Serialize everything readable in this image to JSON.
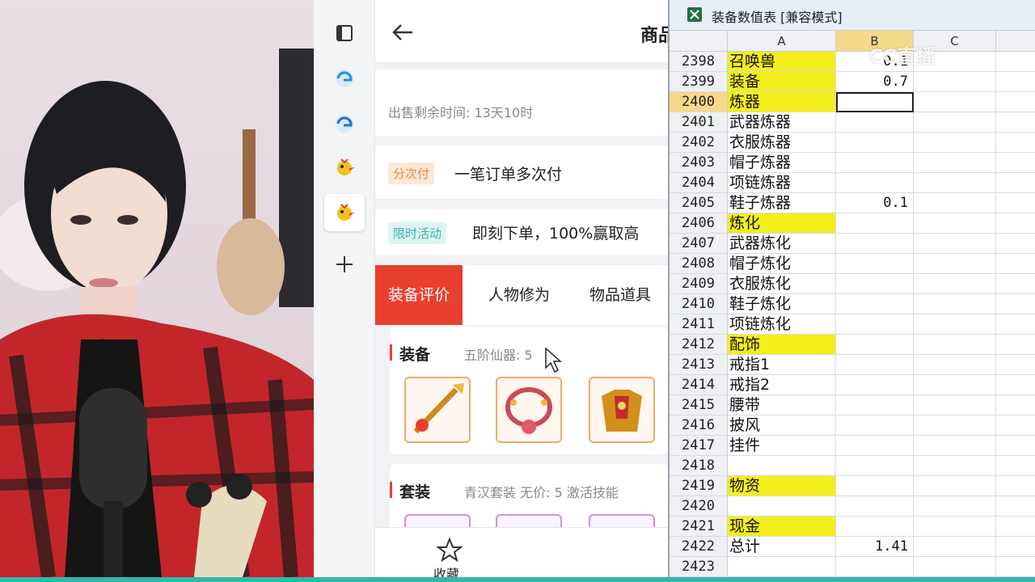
{
  "app": {
    "title": "商品",
    "sale_time": "出售剩余时间: 13天10时",
    "installment_tag": "分次付",
    "installment_text": "一笔订单多次付",
    "promo_tag": "限时活动",
    "promo_text": "即刻下单，100%赢取高",
    "tabs": [
      "装备评价",
      "人物修为",
      "物品道具"
    ],
    "equip_card": {
      "title": "装备",
      "subtitle": "五阶仙器: 5"
    },
    "suit_card": {
      "title": "套装",
      "subtitle": "青汉套装  无价: 5  激活技能"
    },
    "footer_label": "收藏"
  },
  "excel": {
    "title": "装备数值表  [兼容模式]",
    "watermark": "CC直播",
    "columns": [
      "A",
      "B",
      "C"
    ],
    "rows": [
      {
        "n": "2398",
        "a": "召唤兽",
        "b": "0.1",
        "hl": true
      },
      {
        "n": "2399",
        "a": "装备",
        "b": "0.7",
        "hl": true
      },
      {
        "n": "2400",
        "a": "炼器",
        "b": "",
        "hl": true,
        "sel": true
      },
      {
        "n": "2401",
        "a": "武器炼器",
        "b": ""
      },
      {
        "n": "2402",
        "a": "衣服炼器",
        "b": ""
      },
      {
        "n": "2403",
        "a": "帽子炼器",
        "b": ""
      },
      {
        "n": "2404",
        "a": "项链炼器",
        "b": ""
      },
      {
        "n": "2405",
        "a": "鞋子炼器",
        "b": "0.1"
      },
      {
        "n": "2406",
        "a": "炼化",
        "b": "",
        "hl": true
      },
      {
        "n": "2407",
        "a": "武器炼化",
        "b": ""
      },
      {
        "n": "2408",
        "a": "帽子炼化",
        "b": ""
      },
      {
        "n": "2409",
        "a": "衣服炼化",
        "b": ""
      },
      {
        "n": "2410",
        "a": "鞋子炼化",
        "b": ""
      },
      {
        "n": "2411",
        "a": "项链炼化",
        "b": ""
      },
      {
        "n": "2412",
        "a": "配饰",
        "b": "",
        "hl": true
      },
      {
        "n": "2413",
        "a": "戒指1",
        "b": ""
      },
      {
        "n": "2414",
        "a": "戒指2",
        "b": ""
      },
      {
        "n": "2415",
        "a": "腰带",
        "b": ""
      },
      {
        "n": "2416",
        "a": "披风",
        "b": ""
      },
      {
        "n": "2417",
        "a": "挂件",
        "b": ""
      },
      {
        "n": "2418",
        "a": "",
        "b": ""
      },
      {
        "n": "2419",
        "a": "物资",
        "b": "",
        "hl": true
      },
      {
        "n": "2420",
        "a": "",
        "b": ""
      },
      {
        "n": "2421",
        "a": "现金",
        "b": "",
        "hl": true
      },
      {
        "n": "2422",
        "a": "总计",
        "b": "1.41"
      },
      {
        "n": "2423",
        "a": "",
        "b": ""
      }
    ]
  },
  "colors": {
    "accent": "#e8402e",
    "highlight": "#f4ee1a",
    "teal": "#2fb8b0"
  },
  "icons": {
    "rail": [
      "sidebar-toggle-icon",
      "edge-browser-icon",
      "edge-browser-icon",
      "game-mascot-icon",
      "game-mascot-icon",
      "plus-icon"
    ],
    "back": "arrow-left-icon",
    "footer": "star-icon",
    "excel": "excel-icon"
  }
}
